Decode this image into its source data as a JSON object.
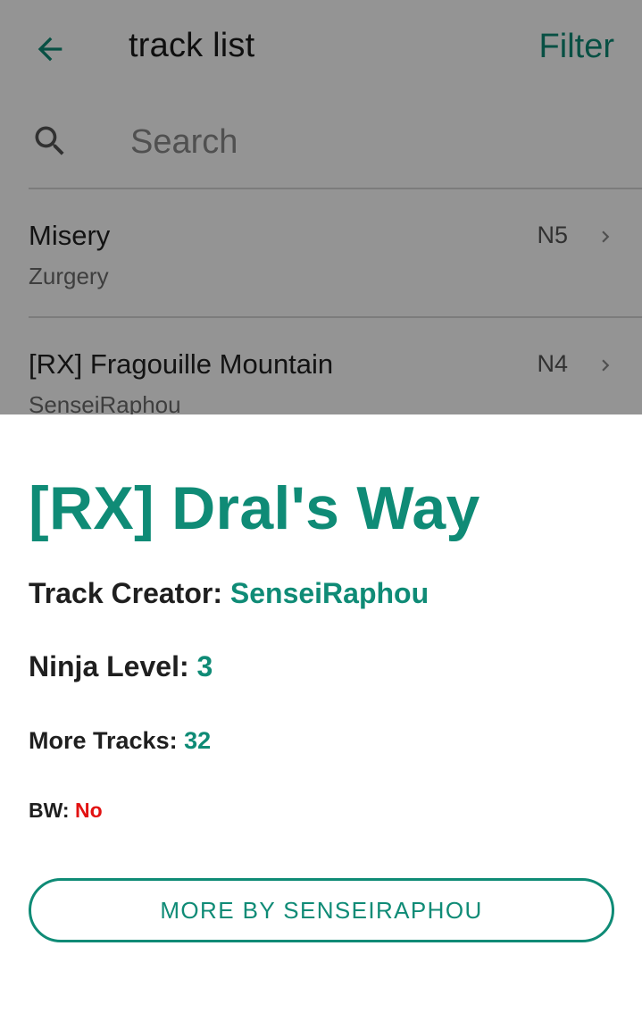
{
  "header": {
    "title": "track list",
    "back_icon": "arrow-left-icon",
    "filter_label": "Filter"
  },
  "search": {
    "placeholder": "Search",
    "value": "",
    "icon": "search-icon"
  },
  "tracks": [
    {
      "title": "Misery",
      "author": "Zurgery",
      "level": "N5"
    },
    {
      "title": "[RX] Fragouille Mountain",
      "author": "SenseiRaphou",
      "level": "N4"
    }
  ],
  "sheet": {
    "title": "[RX] Dral's Way",
    "creator_label": "Track Creator:",
    "creator_value": "SenseiRaphou",
    "level_label": "Ninja Level:",
    "level_value": "3",
    "more_tracks_label": "More Tracks:",
    "more_tracks_value": "32",
    "bw_label": "BW:",
    "bw_value": "No",
    "more_button_label": "MORE BY SENSEIRAPHOU"
  },
  "colors": {
    "accent": "#0f8b76",
    "negative": "#e21212",
    "scrim": "rgba(0,0,0,0.42)"
  }
}
